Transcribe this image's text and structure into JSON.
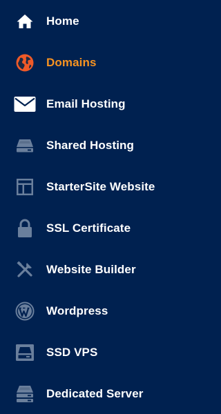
{
  "colors": {
    "background": "#002150",
    "text": "#ffffff",
    "active_text": "#f79321",
    "muted_icon": "#6a7f9c",
    "active_icon": "#ef5a28"
  },
  "nav": {
    "items": [
      {
        "label": "Home",
        "icon": "home-icon",
        "active": false
      },
      {
        "label": "Domains",
        "icon": "globe-icon",
        "active": true
      },
      {
        "label": "Email Hosting",
        "icon": "envelope-icon",
        "active": false
      },
      {
        "label": "Shared Hosting",
        "icon": "server-drive-icon",
        "active": false
      },
      {
        "label": "StarterSite Website",
        "icon": "layout-template-icon",
        "active": false
      },
      {
        "label": "SSL Certificate",
        "icon": "lock-icon",
        "active": false
      },
      {
        "label": "Website Builder",
        "icon": "tools-icon",
        "active": false
      },
      {
        "label": "Wordpress",
        "icon": "wordpress-icon",
        "active": false
      },
      {
        "label": "SSD VPS",
        "icon": "ssd-drive-icon",
        "active": false
      },
      {
        "label": "Dedicated Server",
        "icon": "server-stack-icon",
        "active": false
      }
    ]
  }
}
